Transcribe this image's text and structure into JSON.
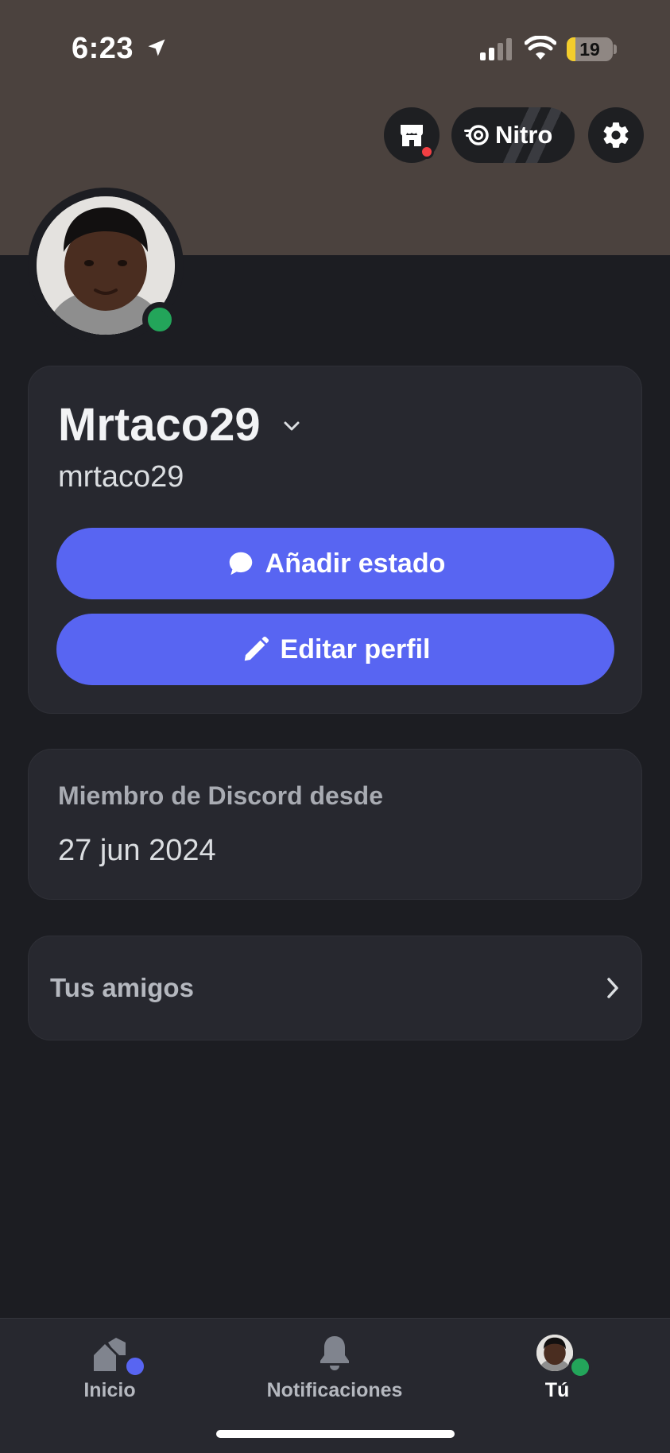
{
  "status_bar": {
    "time": "6:23",
    "battery_level": "19",
    "battery_fraction": 0.19,
    "icons": [
      "location-arrow-icon",
      "cellular-signal-icon",
      "wifi-icon",
      "battery-icon"
    ]
  },
  "header": {
    "shop_icon": "shop-icon",
    "nitro_label": "Nitro",
    "settings_icon": "gear-icon"
  },
  "profile": {
    "display_name": "Mrtaco29",
    "username": "mrtaco29",
    "online_status": "online",
    "add_status_label": "Añadir estado",
    "edit_profile_label": "Editar perfil"
  },
  "member_since": {
    "label": "Miembro de Discord desde",
    "date": "27 jun 2024"
  },
  "friends": {
    "label": "Tus amigos"
  },
  "tabbar": {
    "tabs": [
      {
        "label": "Inicio",
        "icon": "home-icon"
      },
      {
        "label": "Notificaciones",
        "icon": "bell-icon"
      },
      {
        "label": "Tú",
        "icon": "avatar"
      }
    ],
    "active_tab": "Tú"
  },
  "colors": {
    "banner": "#4b423e",
    "background": "#1c1d22",
    "card": "#27282f",
    "blurple": "#5865f2",
    "online_green": "#23a55a",
    "notification_red": "#f23f43"
  }
}
